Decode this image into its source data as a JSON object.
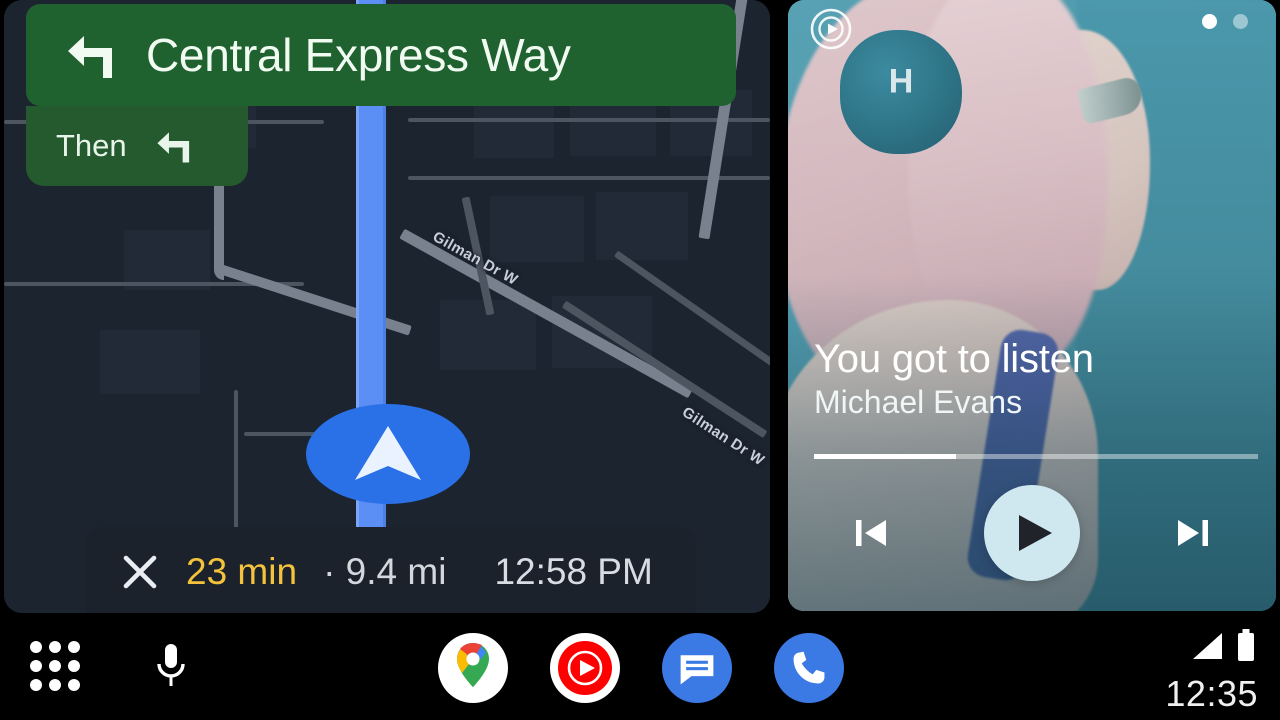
{
  "navigation": {
    "maneuver_icon": "turn-left-icon",
    "street": "Central Express Way",
    "then_label": "Then",
    "then_maneuver_icon": "turn-left-icon",
    "banner_color": "#1f6230",
    "then_color": "#245a2d",
    "route_color": "#5b8ff5",
    "map_background": "#1c2430",
    "street_labels": [
      "Gilman Dr W",
      "Gilman Dr W"
    ],
    "position_marker_icon": "navigation-chevron-icon"
  },
  "trip": {
    "close_icon": "close-icon",
    "eta": "23 min",
    "separator": "·",
    "distance": "9.4 mi",
    "arrival_time": "12:58 PM",
    "eta_color": "#f5c33b",
    "text_color": "#d3d8de"
  },
  "media": {
    "source_icon": "youtube-music-icon",
    "title": "You got to listen",
    "artist": "Michael Evans",
    "progress_percent": 32,
    "page_dots": 2,
    "active_dot": 1,
    "controls": {
      "previous": "skip-previous-icon",
      "play": "play-icon",
      "next": "skip-next-icon"
    },
    "play_button_color": "#cfe8ef",
    "panel_tint": "#44909f"
  },
  "taskbar": {
    "apps_icon": "app-grid-icon",
    "mic_icon": "microphone-icon",
    "apps": [
      {
        "name": "maps",
        "icon": "google-maps-icon"
      },
      {
        "name": "youtube-music",
        "icon": "youtube-music-icon"
      },
      {
        "name": "messages",
        "icon": "messages-icon"
      },
      {
        "name": "phone",
        "icon": "phone-icon"
      }
    ],
    "signal_icon": "signal-bars-icon",
    "battery_icon": "battery-full-icon",
    "clock": "12:35"
  }
}
